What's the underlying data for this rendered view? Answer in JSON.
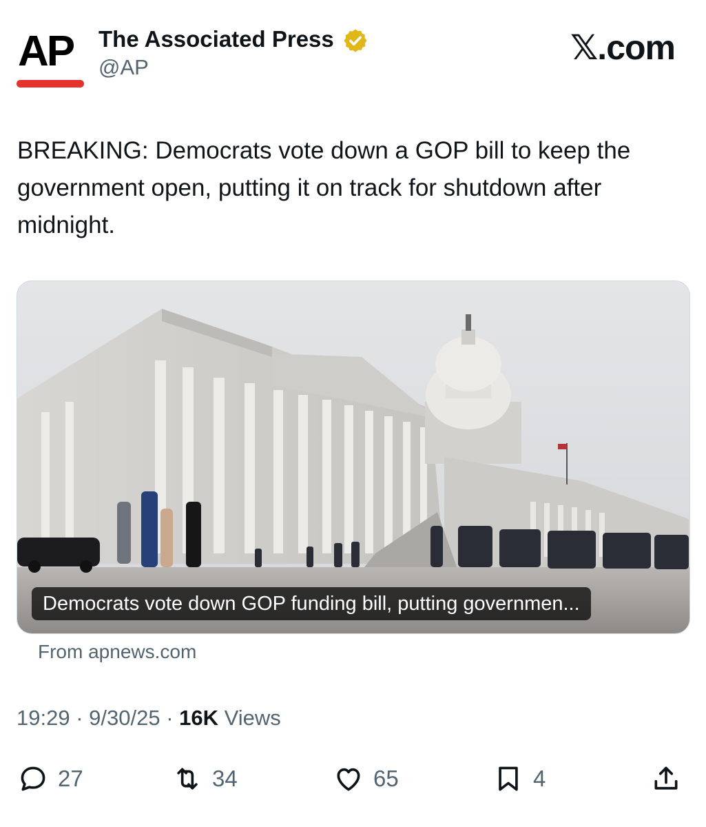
{
  "author": {
    "avatar_text": "AP",
    "name": "The Associated Press",
    "handle": "@AP",
    "verified": true
  },
  "site_mark": "𝕏.com",
  "tweet": {
    "text": "BREAKING: Democrats vote down a GOP bill to keep the government open, putting it on track for shutdown after midnight."
  },
  "card": {
    "caption": "Democrats vote down GOP funding bill, putting governmen...",
    "source": "From apnews.com"
  },
  "meta": {
    "time": "19:29",
    "sep1": " · ",
    "date": "9/30/25",
    "sep2": " · ",
    "views_count": "16K",
    "views_label": " Views"
  },
  "actions": {
    "replies": "27",
    "reposts": "34",
    "likes": "65",
    "bookmarks": "4"
  },
  "colors": {
    "text": "#0f1419",
    "secondary": "#536471",
    "ap_red": "#e5322d",
    "verified_gold": "#e2b719"
  },
  "icons": [
    "verified-badge-icon",
    "reply-icon",
    "repost-icon",
    "like-icon",
    "bookmark-icon",
    "share-icon"
  ]
}
